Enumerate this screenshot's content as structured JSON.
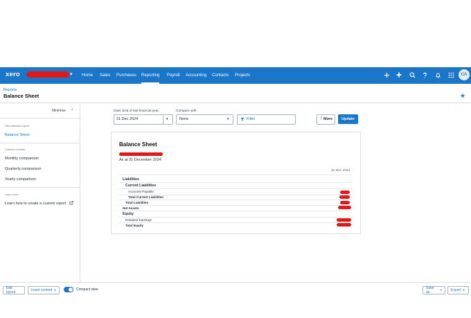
{
  "topbar": {
    "logo": "xero",
    "nav": [
      "Home",
      "Sales",
      "Purchases",
      "Reporting",
      "Payroll",
      "Accounting",
      "Contacts",
      "Projects"
    ],
    "active_nav": "Reporting",
    "avatar": "CA"
  },
  "header": {
    "breadcrumb": "Reports",
    "title": "Balance Sheet"
  },
  "sidebar": {
    "minimise": "Minimise",
    "view_standard": "View standard report",
    "standard_item": "Balance Sheet",
    "common_formats": "Common formats",
    "formats": [
      "Monthly comparison",
      "Quarterly comparison",
      "Yearly comparison"
    ],
    "learn_more": "Learn more",
    "learn_link": "Learn how to create a custom report"
  },
  "filters": {
    "date_label": "Date: End of last financial year",
    "date_value": "31 Dec 2024",
    "compare_label": "Compare with",
    "compare_value": "None",
    "filter_button": "Filter",
    "more_button": "More",
    "update_button": "Update"
  },
  "report": {
    "title": "Balance Sheet",
    "as_at": "As at 31 December 2024",
    "column_header": "31 Dec 2024",
    "rows": {
      "liabilities": "Liabilities",
      "current_liabilities": "Current Liabilities",
      "accounts_payable": "Accounts Payable",
      "total_current_liabilities": "Total Current Liabilities",
      "total_liabilities": "Total Liabilities",
      "net_assets": "Net Assets",
      "equity": "Equity",
      "retained_earnings": "Retained Earnings",
      "total_equity": "Total Equity"
    }
  },
  "footer": {
    "edit_layout": "Edit layout",
    "insert_content": "Insert content",
    "compact_view": "Compact view",
    "save_as": "Save as",
    "export": "Export"
  },
  "colors": {
    "brand": "#1a76c9",
    "redaction": "#e01818"
  }
}
